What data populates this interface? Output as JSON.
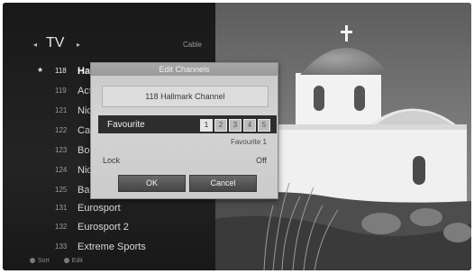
{
  "header": {
    "title": "TV",
    "left_arrow": "◂",
    "right_arrow": "▸",
    "source": "Cable"
  },
  "channels": [
    {
      "number": "118",
      "name": "Ha",
      "selected": true,
      "star": "★"
    },
    {
      "number": "119",
      "name": "Act"
    },
    {
      "number": "121",
      "name": "Nic"
    },
    {
      "number": "122",
      "name": "Ca"
    },
    {
      "number": "123",
      "name": "Bo"
    },
    {
      "number": "124",
      "name": "Nic"
    },
    {
      "number": "125",
      "name": "Bab"
    },
    {
      "number": "131",
      "name": "Eurosport"
    },
    {
      "number": "132",
      "name": "Eurosport 2"
    },
    {
      "number": "133",
      "name": "Extreme Sports"
    }
  ],
  "legend": {
    "sort": "Sort",
    "edit": "Edit"
  },
  "dialog": {
    "title": "Edit Channels",
    "channel_name": "118 Hallmark Channel",
    "favourite_label": "Favourite",
    "favourite_slots": [
      "1",
      "2",
      "3",
      "4",
      "5"
    ],
    "favourite_active": "1",
    "favourite_selected_text": "Favourite 1",
    "lock_label": "Lock",
    "lock_value": "Off",
    "ok_label": "OK",
    "cancel_label": "Cancel"
  },
  "colors": {
    "panel": "#1a1a1a",
    "dialog": "#cfcfcf",
    "favourite_bar": "#2d2d2d",
    "button": "#555555"
  }
}
